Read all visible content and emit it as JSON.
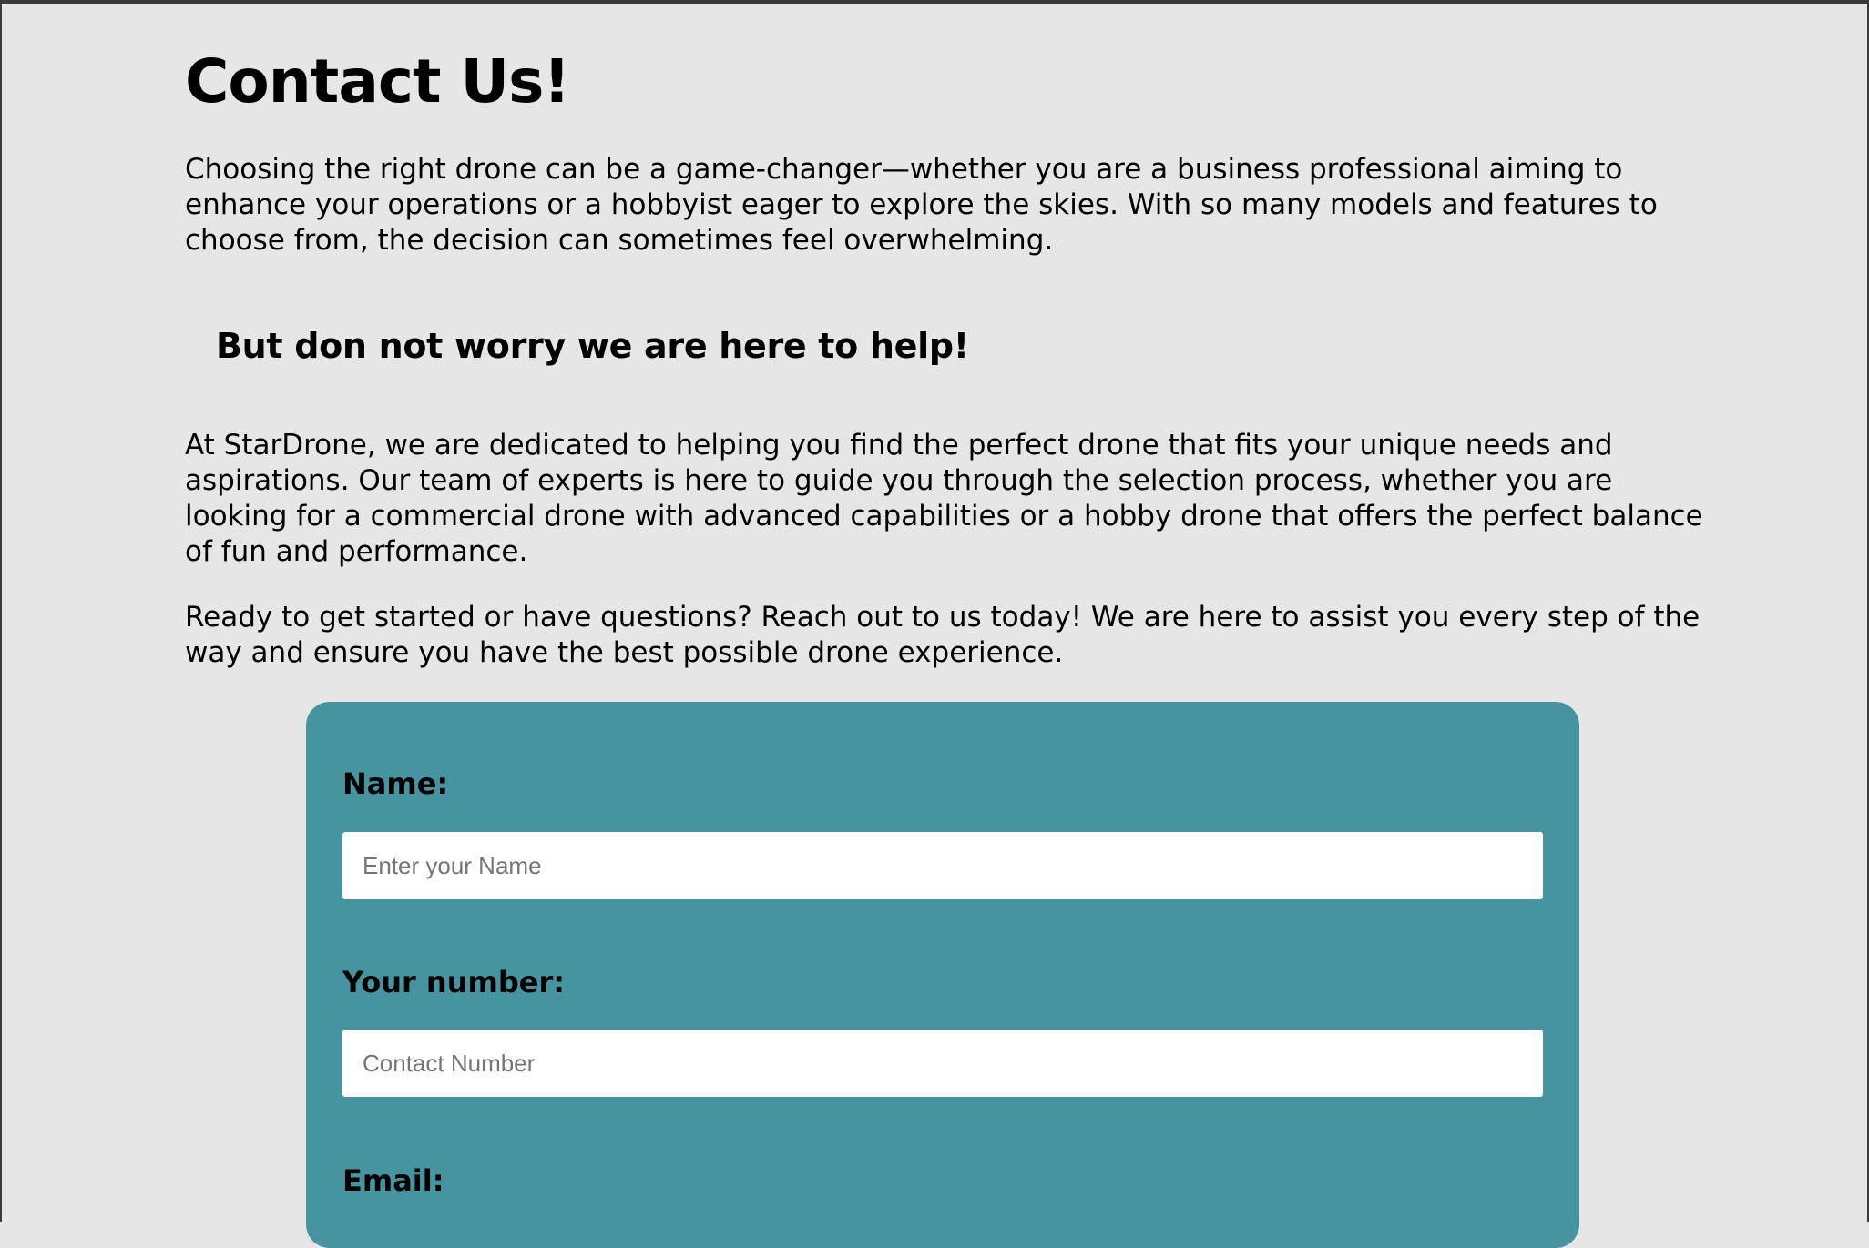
{
  "page": {
    "title": "Contact Us!",
    "intro": "Choosing the right drone can be a game-changer—whether you are a business professional aiming to enhance your operations or a hobbyist eager to explore the skies. With so many models and features to choose from, the decision can sometimes feel overwhelming.",
    "subheading": "But don not worry we are here to help!",
    "about": "At StarDrone, we are dedicated to helping you find the perfect drone that fits your unique needs and aspirations. Our team of experts is here to guide you through the selection process, whether you are looking for a commercial drone with advanced capabilities or a hobby drone that offers the perfect balance of fun and performance.",
    "ready": "Ready to get started or have questions? Reach out to us today! We are here to assist you every step of the way and ensure you have the best possible drone experience."
  },
  "form": {
    "background_color": "#4594a0",
    "name": {
      "label": "Name:",
      "placeholder": "Enter your Name",
      "value": ""
    },
    "number": {
      "label": "Your number:",
      "placeholder": "Contact Number",
      "value": ""
    },
    "email": {
      "label": "Email:"
    }
  }
}
